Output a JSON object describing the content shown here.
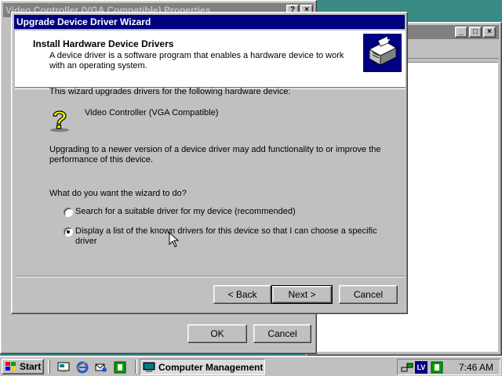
{
  "colors": {
    "desktop": "#3a8a86",
    "active_title": "#000080",
    "inactive_title": "#808080",
    "face": "#c0c0c0"
  },
  "properties_window": {
    "title": "Video Controller (VGA Compatible) Properties",
    "title_buttons": [
      "?",
      "×"
    ],
    "ok_label": "OK",
    "cancel_label": "Cancel"
  },
  "management_window": {
    "title_buttons": [
      "_",
      "□",
      "×"
    ]
  },
  "wizard": {
    "title": "Upgrade Device Driver Wizard",
    "header_title": "Install Hardware Device Drivers",
    "header_description": "A device driver is a software program that enables a hardware device to work with an operating system.",
    "header_icon": "hardware-driver-icon",
    "intro_text": "This wizard upgrades drivers for the following hardware device:",
    "device_icon": "unknown-device-icon",
    "device_name": "Video Controller (VGA Compatible)",
    "upgrade_text": "Upgrading to a newer version of a device driver may add functionality to or improve the performance of this device.",
    "question": "What do you want the wizard to do?",
    "options": [
      {
        "label": "Search for a suitable driver for my device (recommended)",
        "selected": false
      },
      {
        "label": "Display a list of the known drivers for this device so that I can choose a specific driver",
        "selected": true
      }
    ],
    "back_label": "< Back",
    "next_label": "Next >",
    "cancel_label": "Cancel"
  },
  "taskbar": {
    "start_label": "Start",
    "quick_launch": [
      "show-desktop-icon",
      "internet-explorer-icon",
      "outlook-express-icon",
      "app-icon"
    ],
    "active_task": "Computer Management",
    "tray_icons": [
      "network-icon",
      "language-indicator-icon",
      "app-tray-icon"
    ],
    "language_indicator": "LV",
    "clock": "7:46 AM"
  }
}
